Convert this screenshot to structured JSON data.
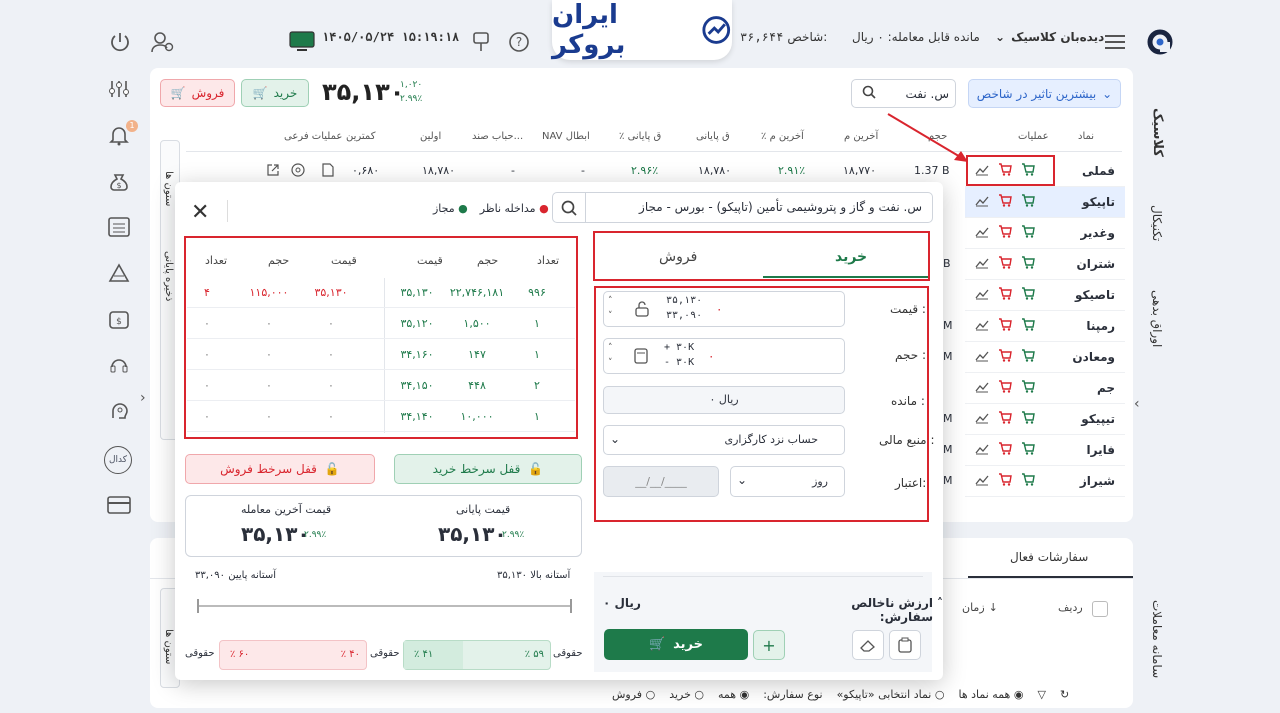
{
  "header": {
    "watchlist_label": "دیده‌بان کلاسیک",
    "balance_label": "مانده قابل معامله: ۰ ریال",
    "index_label": "شاخص:",
    "index_value": "۳۶,۶۴۴",
    "datetime": "۱۴۰۵/۰۵/۲۴ ۱۵:۱۹:۱۸",
    "brand": "ایران بروکر"
  },
  "right_rail": {
    "classic": "کلاسیک",
    "technical": "تکنیکال",
    "bonds": "اوراق بدهی",
    "order_system": "سامانه معاملات"
  },
  "left_rail": {
    "badge": "1",
    "kodal": "کدال"
  },
  "toolbar": {
    "filter_label": "بیشترین تاثیر در شاخص",
    "search_value": "س. نفت",
    "price": "۳۵,۱۳۰",
    "change": "۱,۰۲۰",
    "change_pct": "۲.۹۹٪",
    "buy": "خرید",
    "sell": "فروش"
  },
  "table": {
    "headers": [
      "نماد",
      "عملیات",
      "حجم",
      "آخرین م",
      "٪ آخرین م",
      "ق پایانی",
      "٪ ق پایانی",
      "NAV ابطال",
      "حباب صند...",
      "اولین",
      "کمترین",
      "عملیات فرعی"
    ],
    "first_row": {
      "volume": "1.37 B",
      "last": "۱۸,۷۷۰",
      "last_pct": "۲.۹۱٪",
      "close": "۱۸,۷۸۰",
      "close_pct": "۲.۹۶٪",
      "nav": "-",
      "bubble": "-",
      "first": "۱۸,۷۸۰",
      "low": "۰,۶۸۰"
    },
    "symbols": [
      "فملی",
      "تاپیکو",
      "وغدیر",
      "شتران",
      "تاصیکو",
      "رمپنا",
      "ومعادن",
      "جم",
      "تیپیکو",
      "فایرا",
      "شیراز"
    ],
    "vol_suffix": [
      "B",
      "",
      "",
      "B",
      "",
      "M",
      "M",
      "",
      "M",
      "M",
      "M"
    ]
  },
  "side_tabs": {
    "columns": "ستون ها",
    "save": "ذخیره پایانی",
    "columns2": "ستون ها"
  },
  "dialog": {
    "symbol_full": "س. نفت و گاز و پتروشیمی تأمین (تاپیکو) - بورس - مجاز",
    "legend_allowed": "مجاز",
    "legend_watch": "مداخله ناظر",
    "tab_buy": "خرید",
    "tab_sell": "فروش",
    "price_label": "قیمت :",
    "price_value": "۰",
    "price_max": "۳۵,۱۳۰",
    "price_min": "۳۳,۰۹۰",
    "volume_label": "حجم :",
    "volume_value": "۰",
    "vol_plus": "+ ۳۰K",
    "vol_minus": "- ۳۰K",
    "remain_label": "مانده :",
    "remain_value": "۰ ریال",
    "fund_label": "منبع مالی :",
    "fund_value": "حساب نزد کارگزاری",
    "credit_label": "اعتبار:",
    "credit_value": "روز",
    "date_placeholder": "__/__/____",
    "net_label": "ارزش ناخالص سفارش:",
    "net_value": "۰ ریال",
    "submit": "خرید",
    "plus": "+",
    "lock_buy": "قفل سرخط خرید",
    "lock_sell": "قفل سرخط فروش",
    "close_price_label": "قیمت پایانی",
    "close_price": "۳۵,۱۳۰",
    "close_pct": "۲.۹۹٪",
    "last_price_label": "قیمت آخرین معامله",
    "last_price": "۳۵,۱۳۰",
    "last_pct": "۲.۹۹٪",
    "upper": "آستانه بالا ۳۵,۱۳۰",
    "lower": "۳۳,۰۹۰ آستانه پایین",
    "real_buy_label": "حقوقی",
    "real_buy_pct": "٪ ۵۹",
    "legal_buy_pct": "٪ ۴۱",
    "real_sell_label": "حقوقی",
    "real_sell_pct": "٪ ۴۰",
    "legal_sell_pct": "٪ ۶۰",
    "legal_label": "حقوقی",
    "ob_headers_buy": [
      "تعداد",
      "حجم",
      "قیمت"
    ],
    "ob_headers_sell": [
      "قیمت",
      "حجم",
      "تعداد"
    ],
    "ob_buy": [
      [
        "۹۹۶",
        "۲۲,۷۴۶,۱۸۱",
        "۳۵,۱۳۰"
      ],
      [
        "۱",
        "۱,۵۰۰",
        "۳۵,۱۲۰"
      ],
      [
        "۱",
        "۱۴۷",
        "۳۴,۱۶۰"
      ],
      [
        "۲",
        "۴۴۸",
        "۳۴,۱۵۰"
      ],
      [
        "۱",
        "۱۰,۰۰۰",
        "۳۴,۱۴۰"
      ]
    ],
    "ob_sell": [
      [
        "۳۵,۱۳۰",
        "۱۱۵,۰۰۰",
        "۴"
      ],
      [
        "۰",
        "۰",
        "۰"
      ],
      [
        "۰",
        "۰",
        "۰"
      ],
      [
        "۰",
        "۰",
        "۰"
      ],
      [
        "۰",
        "۰",
        "۰"
      ]
    ]
  },
  "lower": {
    "active_orders": "سفارشات فعال",
    "row": "ردیف",
    "time": "زمان",
    "filters": {
      "all_symbols": "همه نماد ها",
      "selected": "نماد انتخابی «تاپیکو»",
      "order_type": "نوع سفارش:",
      "all": "همه",
      "buy": "خرید",
      "sell": "فروش"
    }
  },
  "colors": {
    "green": "#1e7a4a",
    "red": "#d9252e",
    "blue": "#2e66c9"
  }
}
